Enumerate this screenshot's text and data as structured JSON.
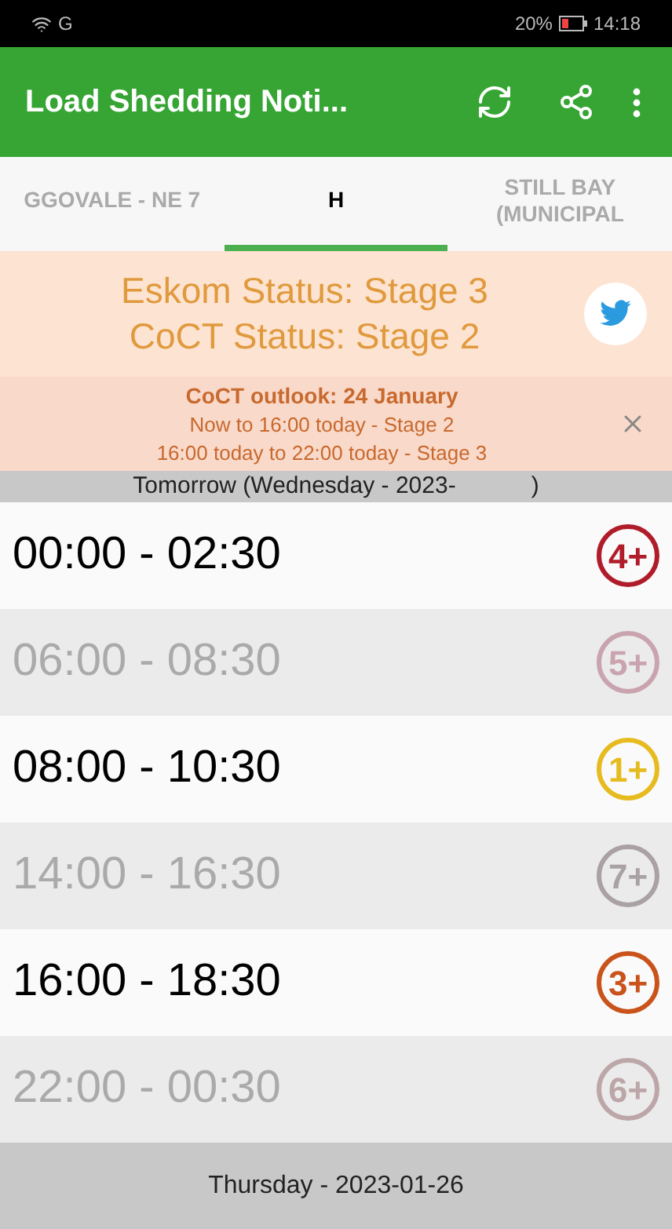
{
  "status_bar": {
    "network": "G",
    "battery": "20%",
    "time": "14:18"
  },
  "app_bar": {
    "title": "Load Shedding Noti..."
  },
  "tabs": [
    {
      "label": "GGOVALE - NE 7",
      "selected": false
    },
    {
      "label": "H",
      "selected": true
    },
    {
      "label": "STILL BAY (MUNICIPAL",
      "selected": false
    }
  ],
  "status": {
    "eskom": "Eskom Status: Stage 3",
    "coct": "CoCT Status: Stage 2"
  },
  "outlook": {
    "title": "CoCT outlook: 24 January",
    "lines": [
      "Now to 16:00 today - Stage 2",
      "16:00 today to 22:00 today - Stage 3"
    ]
  },
  "day_header": {
    "prefix": "Tomorrow (Wednesday - 2023-",
    "suffix": ")"
  },
  "slots": [
    {
      "time": "00:00 - 02:30",
      "stage": "4+",
      "dimmed": false,
      "color": "#b01c2a"
    },
    {
      "time": "06:00 - 08:30",
      "stage": "5+",
      "dimmed": true,
      "color": "#c9a3ae"
    },
    {
      "time": "08:00 - 10:30",
      "stage": "1+",
      "dimmed": false,
      "color": "#e6bb1f"
    },
    {
      "time": "14:00 - 16:30",
      "stage": "7+",
      "dimmed": true,
      "color": "#a9a1a3"
    },
    {
      "time": "16:00 - 18:30",
      "stage": "3+",
      "dimmed": false,
      "color": "#c9531b"
    },
    {
      "time": "22:00 - 00:30",
      "stage": "6+",
      "dimmed": true,
      "color": "#bca6a8"
    }
  ],
  "next_header": "Thursday - 2023-01-26"
}
